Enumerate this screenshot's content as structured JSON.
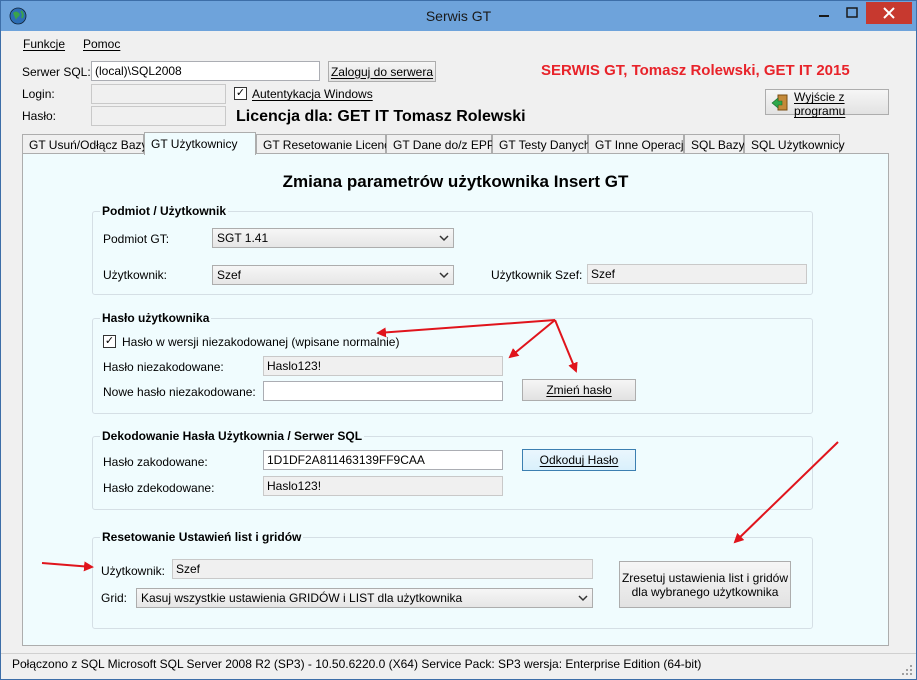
{
  "window": {
    "title": "Serwis GT",
    "minimize": "–",
    "maximize": "□",
    "close": "✕"
  },
  "menu": {
    "funkcje": "Funkcje",
    "pomoc": "Pomoc"
  },
  "login": {
    "server_label": "Serwer SQL:",
    "server_value": "(local)\\SQL2008",
    "connect_button": "Zaloguj do serwera",
    "login_label": "Login:",
    "login_value": "",
    "password_label": "Hasło:",
    "password_value": "",
    "windows_auth_label": "Autentykacja Windows",
    "windows_auth_checked": true,
    "brand_text": "SERWIS GT, Tomasz Rolewski, GET IT 2015",
    "licence_text": "Licencja dla: GET IT Tomasz Rolewski",
    "exit_button": "Wyjście z programu"
  },
  "tabs": [
    {
      "label": "GT Usuń/Odłącz Bazy"
    },
    {
      "label": "GT Użytkownicy"
    },
    {
      "label": "GT Resetowanie Licencji"
    },
    {
      "label": "GT Dane do/z EPP"
    },
    {
      "label": "GT Testy Danych"
    },
    {
      "label": "GT Inne Operacje"
    },
    {
      "label": "SQL Bazy"
    },
    {
      "label": "SQL Użytkownicy"
    }
  ],
  "panel": {
    "title": "Zmiana parametrów użytkownika Insert GT",
    "podmiot": {
      "title": "Podmiot / Użytkownik",
      "podmiot_label": "Podmiot GT:",
      "podmiot_value": "SGT 1.41",
      "user_label": "Użytkownik:",
      "user_value": "Szef",
      "user_szef_label": "Użytkownik Szef:",
      "user_szef_value": "Szef"
    },
    "haslo": {
      "title": "Hasło użytkownika",
      "checkbox_label": "Hasło w wersji niezakodowanej (wpisane normalnie)",
      "checkbox_checked": true,
      "current_label": "Hasło niezakodowane:",
      "current_value": "Haslo123!",
      "new_label": "Nowe hasło niezakodowane:",
      "new_value": "",
      "change_button": "Zmień hasło"
    },
    "dekodowanie": {
      "title": "Dekodowanie Hasła Użytkownia / Serwer SQL",
      "encoded_label": "Hasło zakodowane:",
      "encoded_value": "1D1DF2A811463139FF9CAA",
      "decode_button": "Odkoduj Hasło",
      "decoded_label": "Hasło zdekodowane:",
      "decoded_value": "Haslo123!"
    },
    "reset": {
      "title": "Resetowanie Ustawień list i gridów",
      "user_label": "Użytkownik:",
      "user_value": "Szef",
      "grid_label": "Grid:",
      "grid_value": "Kasuj wszystkie ustawienia GRIDÓW i LIST dla użytkownika",
      "reset_button_line1": "Zresetuj ustawienia list i gridów",
      "reset_button_line2": "dla wybranego użytkownika"
    }
  },
  "status": {
    "text": "Połączono z SQL  Microsoft SQL Server 2008 R2 (SP3) - 10.50.6220.0 (X64)   Service Pack: SP3  wersja: Enterprise Edition (64-bit)"
  },
  "colors": {
    "brand": "#e8232a",
    "annotation_arrow": "#e0141c",
    "panel_bg": "#f0fcfe",
    "titlebar": "#6ea3db"
  }
}
